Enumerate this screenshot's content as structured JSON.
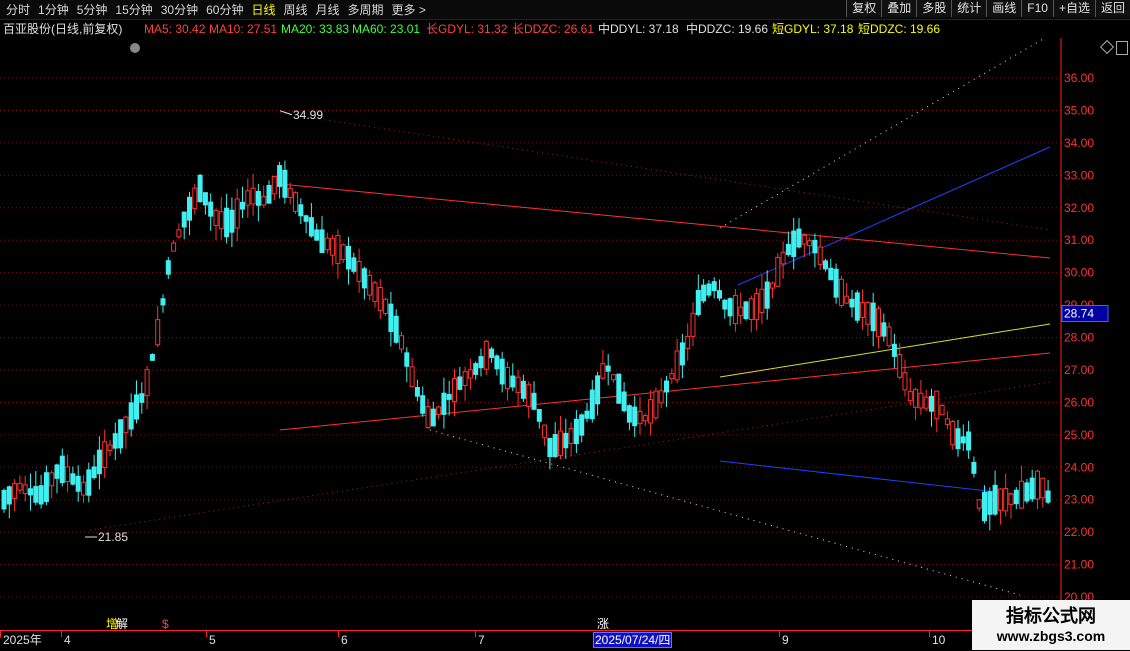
{
  "toolbar": {
    "periods": [
      "分时",
      "1分钟",
      "5分钟",
      "15分钟",
      "30分钟",
      "60分钟",
      "日线",
      "周线",
      "月线",
      "多周期",
      "更多 >"
    ],
    "active_period": "日线",
    "buttons": [
      "复权",
      "叠加",
      "多股",
      "统计",
      "画线",
      "F10",
      "+自选",
      "返回"
    ]
  },
  "stock": {
    "title": "百亚股份(日线,前复权)",
    "indicators": [
      {
        "label": "MA5: 30.42",
        "color": "#ff4040"
      },
      {
        "label": "MA10: 27.51",
        "color": "#ff4040"
      },
      {
        "label": "MA20: 33.83",
        "color": "#40ff40"
      },
      {
        "label": "MA60: 23.01",
        "color": "#40ff40"
      },
      {
        "label": "长GDYL: 31.32",
        "color": "#ff4040"
      },
      {
        "label": "长DDZC: 26.61",
        "color": "#ff4040"
      },
      {
        "label": "中DDYL: 37.18",
        "color": "#e0e0e0"
      },
      {
        "label": "中DDZC: 19.66",
        "color": "#e0e0e0"
      },
      {
        "label": "短GDYL: 37.18",
        "color": "#ffff00"
      },
      {
        "label": "短DDZC: 19.66",
        "color": "#ffff00"
      }
    ]
  },
  "chart_data": {
    "type": "candlestick",
    "y_axis": {
      "min": 19.9,
      "max": 36.5,
      "ticks": [
        20,
        21,
        22,
        23,
        24,
        25,
        26,
        27,
        28,
        29,
        30,
        31,
        32,
        33,
        34,
        35,
        36
      ]
    },
    "current_price": "28.74",
    "high_label": "34.99",
    "low_label": "21.85",
    "month_labels": [
      "2025年",
      "4",
      "5",
      "6",
      "7",
      "9",
      "10"
    ],
    "crosshair_date": "2025/07/24/四",
    "markers": [
      {
        "text": "增",
        "color": "#ffff00"
      },
      {
        "text": "解",
        "color": "#ffffff"
      },
      {
        "text": "$",
        "color": "#ff4040"
      },
      {
        "text": "涨",
        "color": "#ffffff"
      }
    ]
  },
  "watermark": {
    "line1": "指标公式网",
    "line2": "www.zbgs3.com"
  }
}
